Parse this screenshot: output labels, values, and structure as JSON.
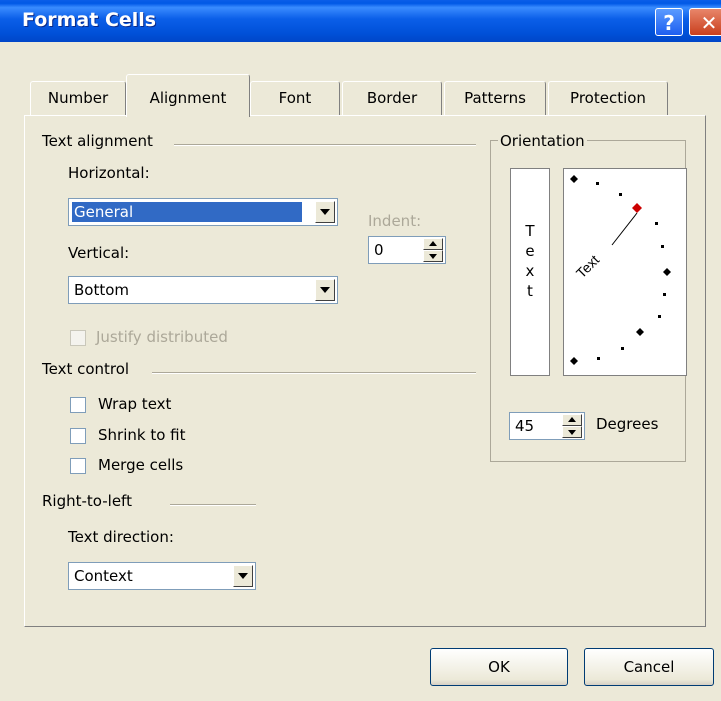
{
  "window": {
    "title": "Format Cells",
    "help_label": "?",
    "close_label": "✕"
  },
  "tabs": [
    "Number",
    "Alignment",
    "Font",
    "Border",
    "Patterns",
    "Protection"
  ],
  "active_tab": "Alignment",
  "text_alignment": {
    "group_label": "Text alignment",
    "horizontal_label": "Horizontal:",
    "horizontal_value": "General",
    "vertical_label": "Vertical:",
    "vertical_value": "Bottom",
    "indent_label": "Indent:",
    "indent_value": "0",
    "justify_distributed_label": "Justify distributed"
  },
  "text_control": {
    "group_label": "Text control",
    "wrap_text": {
      "label": "Wrap text",
      "checked": false
    },
    "shrink_to_fit": {
      "label": "Shrink to fit",
      "checked": false
    },
    "merge_cells": {
      "label": "Merge cells",
      "checked": false
    }
  },
  "right_to_left": {
    "group_label": "Right-to-left",
    "text_direction_label": "Text direction:",
    "text_direction_value": "Context"
  },
  "orientation": {
    "group_label": "Orientation",
    "vertical_text": [
      "T",
      "e",
      "x",
      "t"
    ],
    "dial_text": "Text",
    "degrees_value": "45",
    "degrees_label": "Degrees",
    "marker_color": "#cc0000"
  },
  "buttons": {
    "ok": "OK",
    "cancel": "Cancel"
  }
}
